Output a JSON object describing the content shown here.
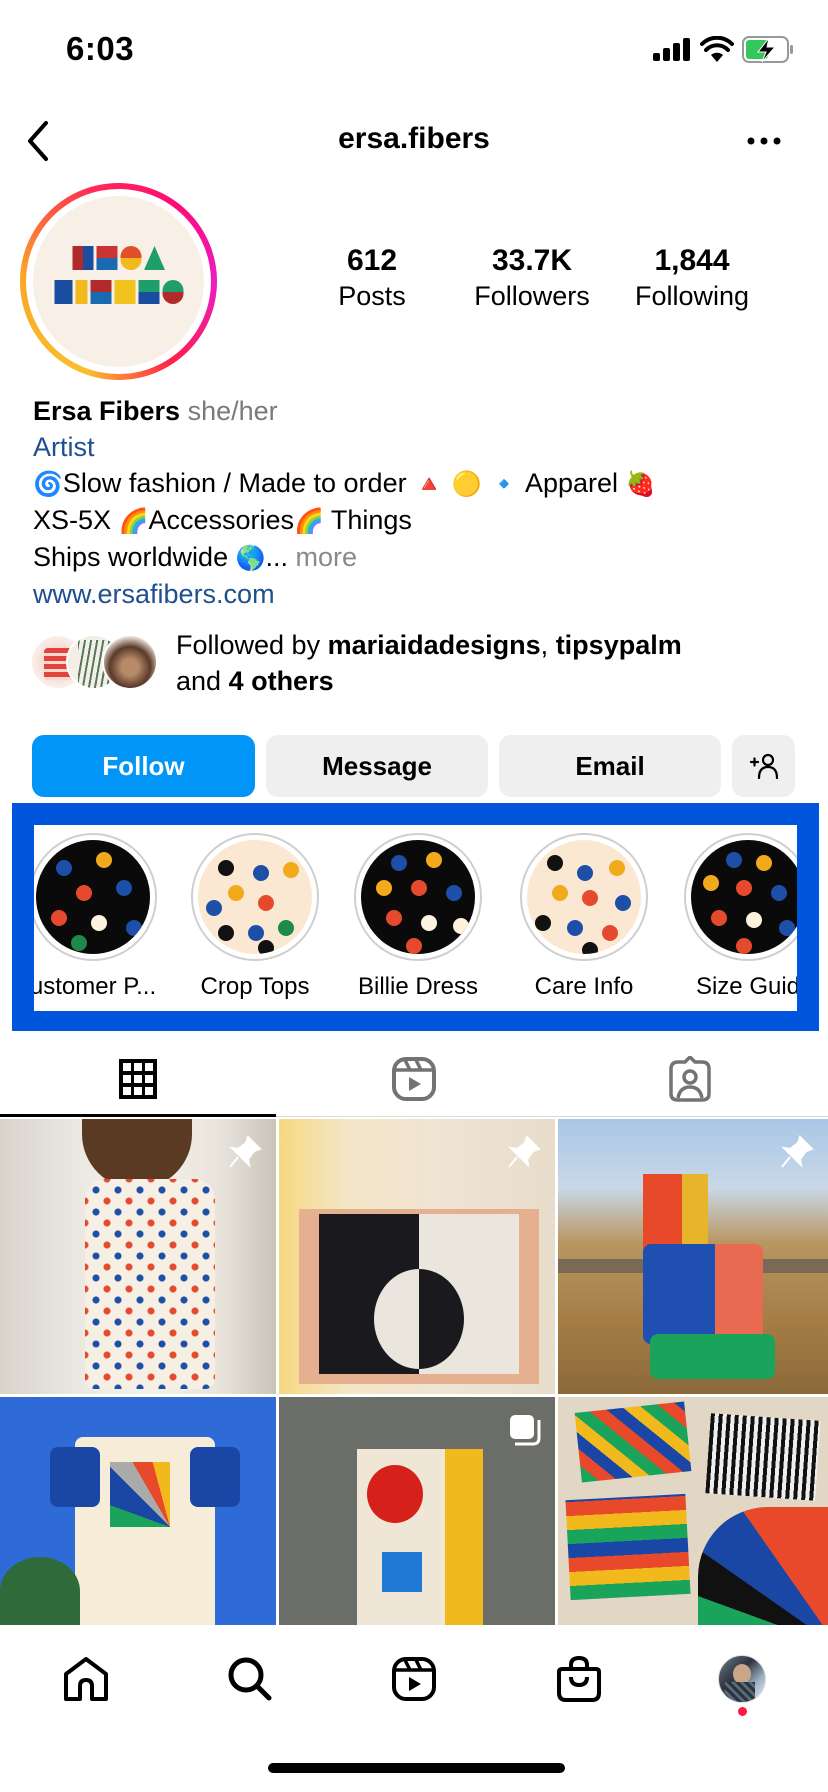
{
  "status_bar": {
    "time": "6:03",
    "icons": [
      "signal-icon",
      "wifi-icon",
      "battery-charging-icon"
    ],
    "battery_color": "#34c759"
  },
  "header": {
    "back_icon": "chevron-left-icon",
    "username": "ersa.fibers",
    "more_icon": "ellipsis-icon"
  },
  "profile": {
    "avatar_text": "ERSA FIBERS",
    "stats": [
      {
        "value": "612",
        "label": "Posts"
      },
      {
        "value": "33.7K",
        "label": "Followers"
      },
      {
        "value": "1,844",
        "label": "Following"
      }
    ],
    "display_name": "Ersa Fibers",
    "pronouns": "she/her",
    "category": "Artist",
    "bio_lines": [
      {
        "emoji_start": "🌀",
        "text": "Slow fashion / Made to order ",
        "emojis": "🔺 🟡 🔹",
        "text2": "  Apparel ",
        "emoji_end": "🍓"
      },
      {
        "text": "XS-5X ",
        "emoji1": "🌈",
        "text2": "Accessories",
        "emoji2": "🌈",
        "text3": " Things"
      },
      {
        "text": "Ships worldwide ",
        "emoji": "🌎",
        "ellipsis": "...",
        "more": " more"
      }
    ],
    "website": "www.ersafibers.com",
    "followed_by": {
      "prefix": "Followed by ",
      "user1": "mariaidadesigns",
      "sep": ", ",
      "user2": "tipsypalm",
      "and": "and ",
      "others": "4 others"
    }
  },
  "actions": {
    "follow": "Follow",
    "message": "Message",
    "email": "Email",
    "add_user_icon": "add-person-icon",
    "follow_color": "#0095f6"
  },
  "highlights": {
    "frame_color": "#0055dd",
    "items": [
      {
        "label": "ustomer P...",
        "style": "dark"
      },
      {
        "label": "Crop Tops",
        "style": "light"
      },
      {
        "label": "Billie Dress",
        "style": "dark"
      },
      {
        "label": "Care Info",
        "style": "light"
      },
      {
        "label": "Size Guid",
        "style": "dark"
      }
    ]
  },
  "profile_tabs": [
    {
      "name": "posts-grid",
      "icon": "grid-icon",
      "active": true
    },
    {
      "name": "reels",
      "icon": "reels-icon",
      "active": false
    },
    {
      "name": "tagged",
      "icon": "tagged-person-icon",
      "active": false
    }
  ],
  "posts": [
    {
      "desc": "Child in floral print dress",
      "badge": "pin-icon"
    },
    {
      "desc": "Black and white color block top",
      "badge": "pin-icon"
    },
    {
      "desc": "Woman in rainbow color block dress on fence",
      "badge": "pin-icon"
    },
    {
      "desc": "Patchwork sunburst dress on hanger",
      "badge": null
    },
    {
      "desc": "Geometric patchwork wall hanging",
      "badge": "carousel-icon"
    },
    {
      "desc": "Quilted patchwork blocks",
      "badge": null
    }
  ],
  "bottom_nav": [
    {
      "name": "home",
      "icon": "home-icon"
    },
    {
      "name": "search",
      "icon": "search-icon"
    },
    {
      "name": "reels",
      "icon": "reels-icon"
    },
    {
      "name": "shop",
      "icon": "shopping-bag-icon"
    },
    {
      "name": "profile",
      "icon": "profile-avatar",
      "notification": true
    }
  ]
}
